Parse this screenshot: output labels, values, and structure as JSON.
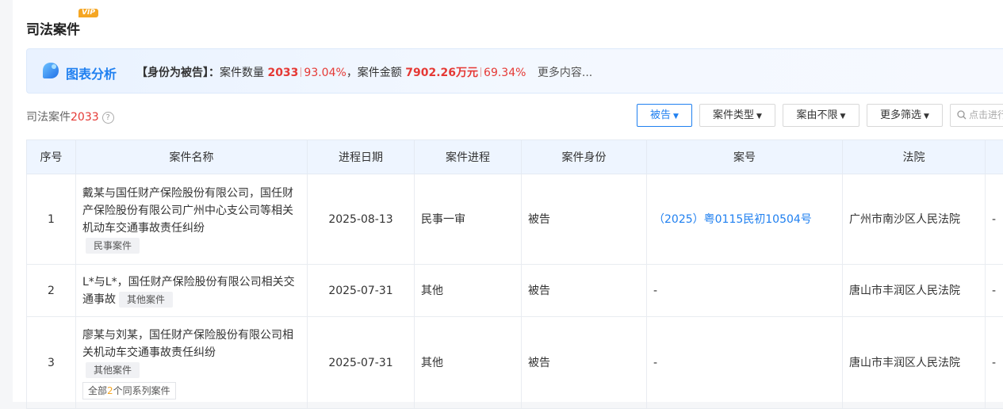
{
  "section": {
    "title": "司法案件",
    "vip": "VIP"
  },
  "analysis": {
    "title": "图表分析",
    "role_label": "【身份为被告】：",
    "count_label": "案件数量",
    "count_value": "2033",
    "count_pct": "93.04%",
    "amount_label": "，案件金额",
    "amount_value": "7902.26万元",
    "amount_pct": "69.34%",
    "more": "更多内容..."
  },
  "list": {
    "label": "司法案件",
    "count": "2033",
    "help": "?"
  },
  "filters": {
    "role": "被告",
    "case_type": "案件类型",
    "cause": "案由不限",
    "more": "更多筛选",
    "search_placeholder": "点击进行搜索"
  },
  "table": {
    "headers": [
      "序号",
      "案件名称",
      "进程日期",
      "案件进程",
      "案件身份",
      "案号",
      "法院",
      ""
    ],
    "rows": [
      {
        "index": "1",
        "name": "戴某与国任财产保险股份有限公司，国任财产保险股份有限公司广州中心支公司等相关机动车交通事故责任纠纷",
        "tag": "民事案件",
        "date": "2025-08-13",
        "stage": "民事一审",
        "role": "被告",
        "case_no": "（2025）粤0115民初10504号",
        "court": "广州市南沙区人民法院",
        "extra": "-"
      },
      {
        "index": "2",
        "name": "L*与L*，国任财产保险股份有限公司相关交通事故",
        "tag": "其他案件",
        "date": "2025-07-31",
        "stage": "其他",
        "role": "被告",
        "case_no": "-",
        "court": "唐山市丰润区人民法院",
        "extra": "-"
      },
      {
        "index": "3",
        "name": "廖某与刘某，国任财产保险股份有限公司相关机动车交通事故责任纠纷",
        "tag": "其他案件",
        "series_prefix": "全部",
        "series_count": "2",
        "series_suffix": "个同系列案件",
        "date": "2025-07-31",
        "stage": "其他",
        "role": "被告",
        "case_no": "-",
        "court": "唐山市丰润区人民法院",
        "extra": "-"
      }
    ]
  }
}
